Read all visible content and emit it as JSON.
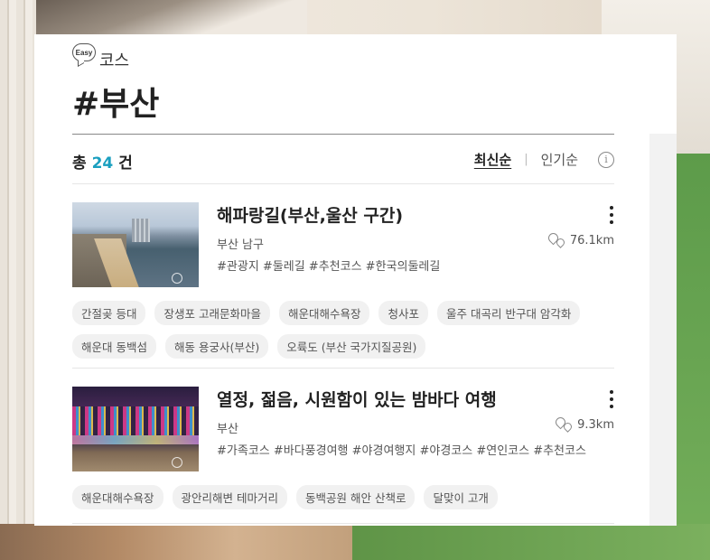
{
  "header": {
    "badge": "Easy",
    "course_label": "코스",
    "title": "#부산"
  },
  "summary": {
    "prefix": "총",
    "count": "24",
    "suffix": "건"
  },
  "sort": {
    "latest": "최신순",
    "separator": "|",
    "popular": "인기순",
    "info": "i"
  },
  "items": [
    {
      "title": "해파랑길(부산,울산 구간)",
      "region": "부산 남구",
      "distance": "76.1km",
      "hashtags": "#관광지 #둘레길 #추천코스 #한국의둘레길",
      "tags": [
        "간절곶 등대",
        "장생포 고래문화마을",
        "해운대해수욕장",
        "청사포",
        "울주 대곡리 반구대 암각화",
        "해운대 동백섬",
        "해동 용궁사(부산)",
        "오륙도 (부산 국가지질공원)"
      ]
    },
    {
      "title": "열정, 젊음, 시원함이 있는 밤바다 여행",
      "region": "부산",
      "distance": "9.3km",
      "hashtags": "#가족코스 #바다풍경여행 #야경여행지 #야경코스 #연인코스 #추천코스",
      "tags": [
        "해운대해수욕장",
        "광안리해변 테마거리",
        "동백공원 해안 산책로",
        "달맞이 고개"
      ]
    }
  ]
}
